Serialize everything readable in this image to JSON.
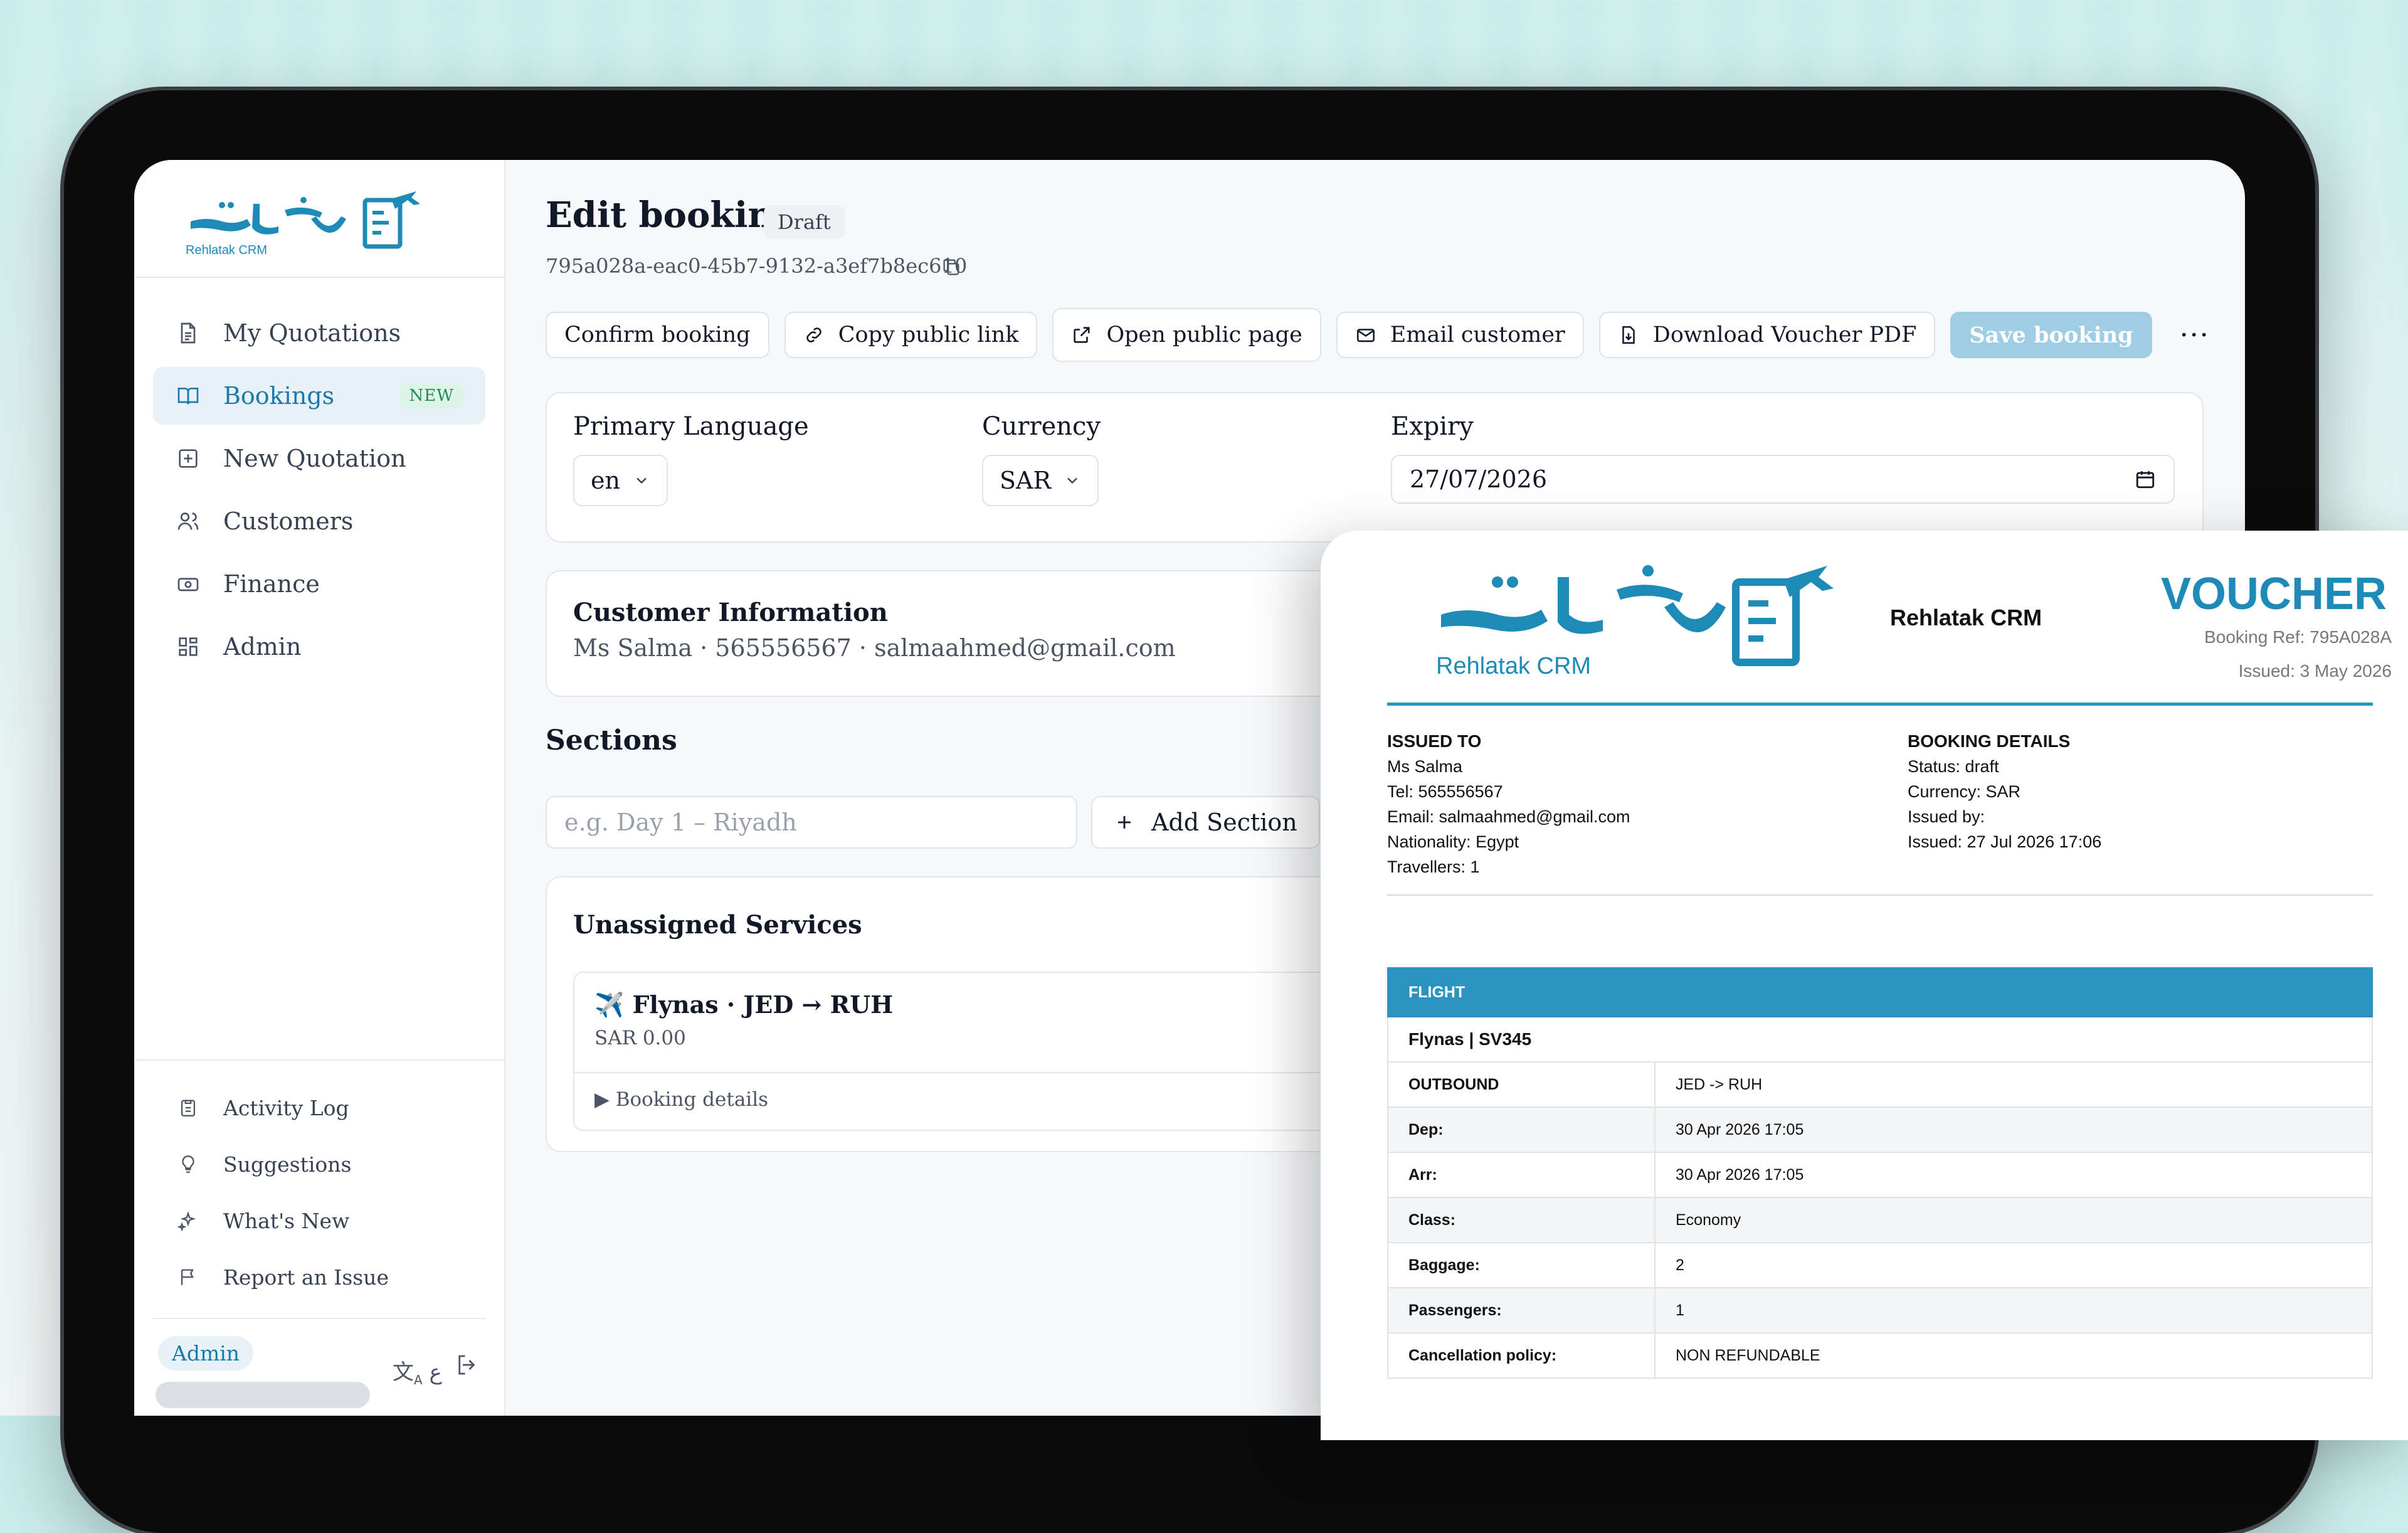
{
  "sidebar": {
    "logo_text": "Rehlatak CRM",
    "items": [
      {
        "label": "My Quotations",
        "icon": "document-icon"
      },
      {
        "label": "Bookings",
        "icon": "book-icon",
        "badge": "NEW"
      },
      {
        "label": "New Quotation",
        "icon": "plus-square-icon"
      },
      {
        "label": "Customers",
        "icon": "users-icon"
      },
      {
        "label": "Finance",
        "icon": "banknote-icon"
      },
      {
        "label": "Admin",
        "icon": "grid-icon"
      }
    ],
    "bottom_items": [
      {
        "label": "Activity Log",
        "icon": "clipboard-icon"
      },
      {
        "label": "Suggestions",
        "icon": "lightbulb-icon"
      },
      {
        "label": "What's New",
        "icon": "sparkles-icon"
      },
      {
        "label": "Report an Issue",
        "icon": "flag-icon"
      }
    ],
    "user_role": "Admin",
    "lang_toggle": "ع"
  },
  "page": {
    "title": "Edit booking",
    "status": "Draft",
    "booking_id": "795a028a-eac0-45b7-9132-a3ef7b8ec610"
  },
  "actions": {
    "confirm": "Confirm booking",
    "copy_link": "Copy public link",
    "open_public": "Open public page",
    "email": "Email customer",
    "download": "Download Voucher PDF",
    "save": "Save booking",
    "more": "···"
  },
  "settings": {
    "language_label": "Primary Language",
    "language_value": "en",
    "currency_label": "Currency",
    "currency_value": "SAR",
    "expiry_label": "Expiry",
    "expiry_value": "27/07/2026"
  },
  "customer": {
    "title": "Customer Information",
    "line": "Ms Salma · 565556567 · salmaahmed@gmail.com"
  },
  "sections": {
    "title": "Sections",
    "placeholder": "e.g. Day 1 – Riyadh",
    "add_label": "Add Section"
  },
  "unassigned": {
    "title": "Unassigned Services",
    "service_title": "✈️ Flynas · JED → RUH",
    "service_price": "SAR 0.00",
    "details_label": "▶ Booking details"
  },
  "voucher": {
    "brand": "Rehlatak CRM",
    "title": "VOUCHER",
    "booking_ref": "Booking Ref: 795A028A",
    "issued": "Issued: 3 May 2026",
    "issued_to": {
      "heading": "ISSUED TO",
      "lines": [
        "Ms Salma",
        "Tel: 565556567",
        "Email: salmaahmed@gmail.com",
        "Nationality: Egypt",
        "Travellers: 1"
      ]
    },
    "booking_details": {
      "heading": "BOOKING DETAILS",
      "lines": [
        "Status: draft",
        "Currency: SAR",
        "Issued by:",
        "Issued: 27 Jul 2026 17:06"
      ]
    },
    "flight": {
      "header": "FLIGHT",
      "name": "Flynas | SV345",
      "rows": [
        {
          "k": "OUTBOUND",
          "v": "JED -> RUH"
        },
        {
          "k": "Dep:",
          "v": "30 Apr 2026 17:05"
        },
        {
          "k": "Arr:",
          "v": "30 Apr 2026 17:05"
        },
        {
          "k": "Class:",
          "v": "Economy"
        },
        {
          "k": "Baggage:",
          "v": "2"
        },
        {
          "k": "Passengers:",
          "v": "1"
        },
        {
          "k": "Cancellation policy:",
          "v": "NON REFUNDABLE"
        }
      ]
    }
  },
  "colors": {
    "brand": "#1d79a8",
    "voucher_accent": "#2a93bf",
    "save_disabled": "#9fcde3"
  }
}
